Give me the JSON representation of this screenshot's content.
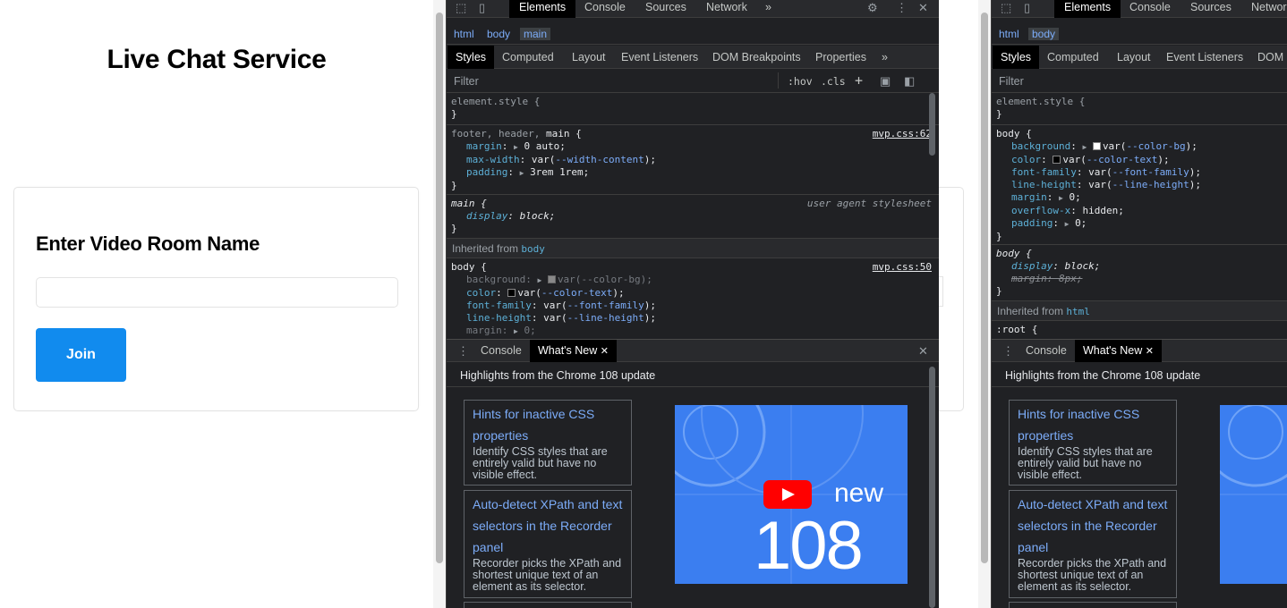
{
  "app": {
    "title": "Live Chat Service",
    "card_title": "Enter Video Room Name",
    "room_input": {
      "value": "",
      "placeholder": ""
    },
    "join_label": "Join",
    "accent": "#118bee"
  },
  "devtools": {
    "main_tabs": [
      "Elements",
      "Console",
      "Sources",
      "Network"
    ],
    "main_tabs_cut": [
      "Elements",
      "Console",
      "Sources",
      "Networ"
    ],
    "more_symbol": "»",
    "close_symbol": "✕",
    "breadcrumbs_1": [
      "html",
      "body",
      "main"
    ],
    "breadcrumbs_2": [
      "html",
      "body"
    ],
    "sub_tabs": [
      "Styles",
      "Computed",
      "Layout",
      "Event Listeners",
      "DOM Breakpoints",
      "Properties"
    ],
    "sub_tabs_cut": [
      "Styles",
      "Computed",
      "Layout",
      "Event Listeners",
      "DOM"
    ],
    "filter_placeholder": "Filter",
    "hov": ":hov",
    "cls": ".cls",
    "plus": "+",
    "panel1": {
      "element_style": "element.style {",
      "close_brace": "}",
      "rule_fhm": {
        "sel_dim": "footer, header, ",
        "sel": "main",
        "open": " {",
        "src": "mvp.css:62",
        "decls": [
          {
            "name": "margin",
            "value": "0 auto;"
          },
          {
            "name": "max-width",
            "value_pre": "var(",
            "var": "--width-content",
            "value_post": ");"
          },
          {
            "name": "padding",
            "value": "3rem 1rem;"
          }
        ]
      },
      "rule_main": {
        "sel": "main {",
        "src": "user agent stylesheet",
        "decl_name": "display",
        "decl_value": "block;"
      },
      "inherited_label": "Inherited from",
      "inherited_from": "body",
      "rule_body": {
        "sel": "body {",
        "src": "mvp.css:50",
        "decls": [
          {
            "name": "background",
            "value_pre": "var(",
            "var": "--color-bg",
            "value_post": ");"
          },
          {
            "name": "color",
            "value_pre": "var(",
            "var": "--color-text",
            "value_post": ");"
          },
          {
            "name": "font-family",
            "value_pre": "var(",
            "var": "--font-family",
            "value_post": ");"
          },
          {
            "name": "line-height",
            "value_pre": "var(",
            "var": "--line-height",
            "value_post": ");"
          },
          {
            "name": "margin",
            "value": "0;"
          }
        ]
      }
    },
    "panel2": {
      "element_style": "element.style {",
      "close_brace": "}",
      "rule_body": {
        "sel": "body {",
        "decls": [
          {
            "name": "background",
            "value_pre": "var(",
            "var": "--color-bg",
            "value_post": ");"
          },
          {
            "name": "color",
            "value_pre": "var(",
            "var": "--color-text",
            "value_post": ");"
          },
          {
            "name": "font-family",
            "value_pre": "var(",
            "var": "--font-family",
            "value_post": ");"
          },
          {
            "name": "line-height",
            "value_pre": "var(",
            "var": "--line-height",
            "value_post": ");"
          },
          {
            "name": "margin",
            "value": "0;"
          },
          {
            "name": "overflow-x",
            "value": "hidden;"
          },
          {
            "name": "padding",
            "value": "0;"
          }
        ]
      },
      "rule_body_ua": {
        "sel": "body {",
        "decl_name": "display",
        "decl_value": "block;",
        "strike": "margin: 8px;"
      },
      "inherited_label": "Inherited from",
      "inherited_from": "html",
      "root_sel": ":root {"
    },
    "drawer_tabs": [
      "Console",
      "What's New"
    ],
    "whats_new_heading": "Highlights from the Chrome 108 update",
    "highlights": [
      {
        "title": "Hints for inactive CSS properties",
        "desc": "Identify CSS styles that are entirely valid but have no visible effect."
      },
      {
        "title": "Auto-detect XPath and text selectors in the Recorder panel",
        "desc": "Recorder picks the XPath and shortest unique text of an element as its selector."
      }
    ],
    "video": {
      "new_label": "new",
      "number": "108"
    }
  }
}
